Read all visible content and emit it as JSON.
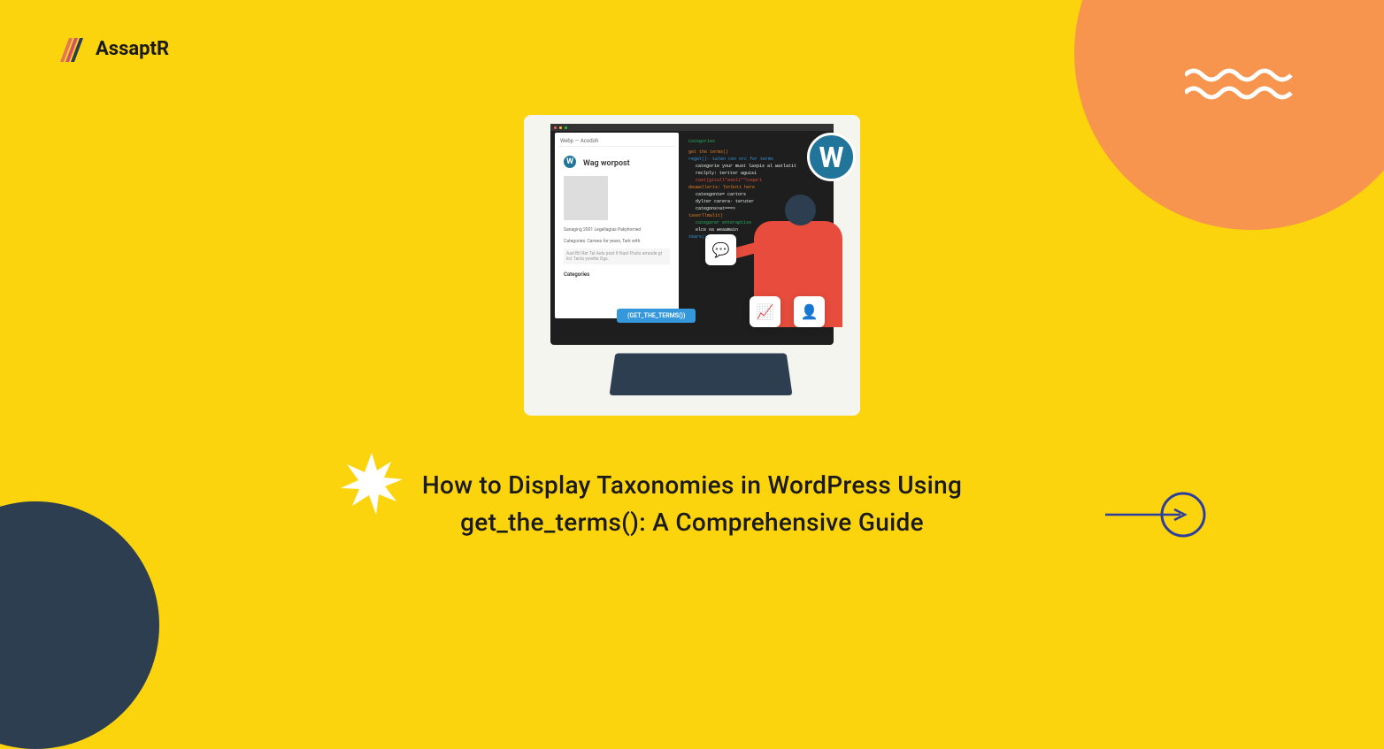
{
  "brand": {
    "name": "AssaptR"
  },
  "heading": {
    "line1": "How to Display Taxonomies in WordPress Using",
    "line2": "get_the_terms(): A Comprehensive Guide"
  },
  "illustration": {
    "browser_tab": "Webp — Acodoh",
    "post_title": "Wag worpost",
    "meta1": "Sanaging 2001 Legellagias Pakyhomed",
    "meta2": "Categories: Carwes for years, Tark with",
    "excerpt": "Aad Bit Rer Tal Aels post It Nast Posts arrasde gt lict Tects yorette Ogs.",
    "categories": "Categories",
    "code_header": "Categories",
    "code_line1": "get the terms()",
    "code_line2": "reget()- talen cen orc for terms",
    "code_line3": "categorie your must laxpis al watlatit",
    "code_line4": "reclply: terttor aguisi",
    "code_line5": "cast)gitall\"aseli\"\"coqari",
    "code_line6": "deuwellerts: TerDoti here",
    "code_line7": "catesgonte= cartors",
    "code_line8": "dylter carera- teruter",
    "code_line9": "categons>at===>",
    "code_line10": "taserTlmalit)",
    "code_line11": "categarer enteraptiss",
    "code_line12": "elce oa weaamain",
    "code_line13": "tears(>= Diswests",
    "badge": "(GET_THE_TERMS())",
    "wp_letter": "W"
  }
}
